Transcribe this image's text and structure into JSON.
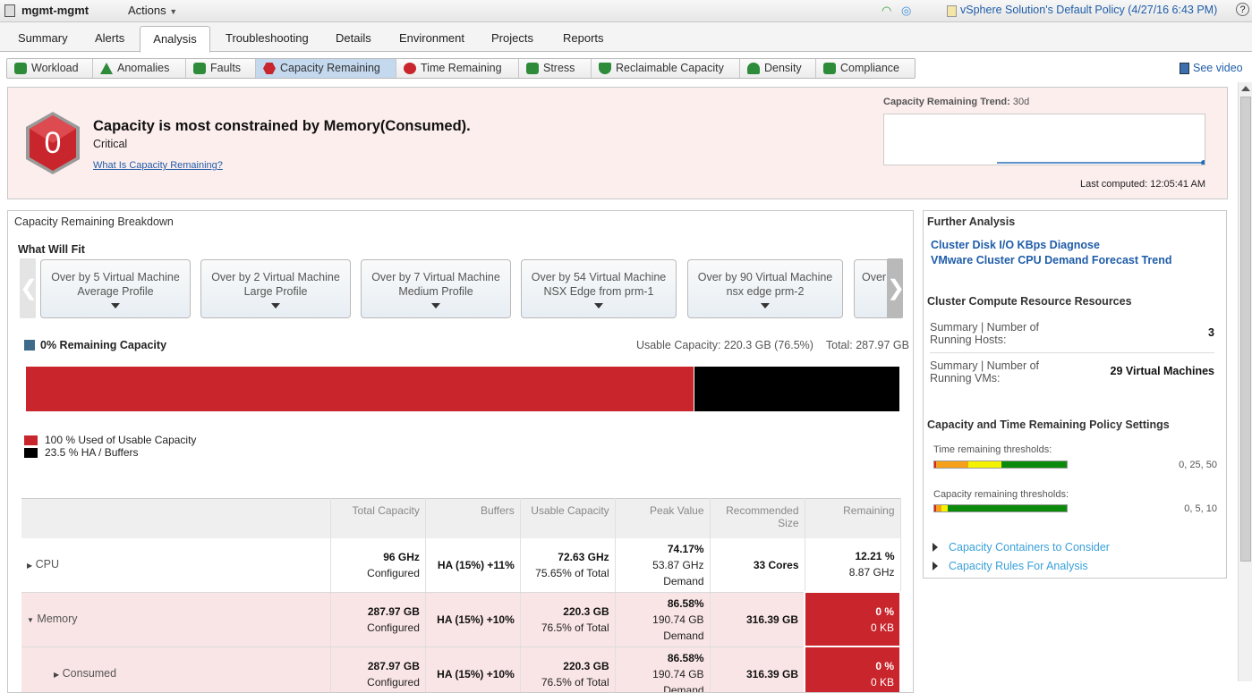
{
  "topbar": {
    "object_name": "mgmt-mgmt",
    "actions_label": "Actions",
    "policy_text": "vSphere Solution's Default Policy (4/27/16 6:43 PM)",
    "help_label": "?"
  },
  "tabs": [
    "Summary",
    "Alerts",
    "Analysis",
    "Troubleshooting",
    "Details",
    "Environment",
    "Projects",
    "Reports"
  ],
  "active_tab": "Analysis",
  "subtabs": [
    "Workload",
    "Anomalies",
    "Faults",
    "Capacity Remaining",
    "Time Remaining",
    "Stress",
    "Reclaimable Capacity",
    "Density",
    "Compliance"
  ],
  "active_subtab": "Capacity Remaining",
  "see_video": "See video",
  "summary": {
    "badge_value": "0",
    "headline": "Capacity is most constrained by Memory(Consumed).",
    "status": "Critical",
    "what_is_link": "What Is Capacity Remaining?",
    "trend_label": "Capacity Remaining Trend:",
    "trend_period": "30d",
    "last_computed": "Last computed: 12:05:41 AM"
  },
  "breakdown": {
    "title": "Capacity Remaining Breakdown",
    "what_will_fit": "What Will Fit",
    "fit_cards": [
      {
        "line1": "Over by 5 Virtual Machine",
        "line2": "Average Profile"
      },
      {
        "line1": "Over by 2 Virtual Machine",
        "line2": "Large Profile"
      },
      {
        "line1": "Over by 7 Virtual Machine",
        "line2": "Medium Profile"
      },
      {
        "line1": "Over by 54 Virtual Machine",
        "line2": "NSX Edge from prm-1"
      },
      {
        "line1": "Over by 90 Virtual Machine",
        "line2": "nsx edge prm-2"
      },
      {
        "line1": "Over",
        "line2": ""
      }
    ],
    "remaining_label": "0% Remaining Capacity",
    "usable_capacity": "Usable Capacity: 220.3 GB (76.5%)",
    "total": "Total: 287.97 GB",
    "bar": {
      "used_fraction": 0.765,
      "buffer_fraction": 0.235
    },
    "legend": {
      "used": "100 % Used of Usable Capacity",
      "buffers": "23.5 % HA / Buffers"
    },
    "table": {
      "headers": [
        "",
        "Total Capacity",
        "Buffers",
        "Usable Capacity",
        "Peak Value",
        "Recommended Size",
        "Remaining"
      ],
      "rows": [
        {
          "name": "CPU",
          "total": "96 GHz",
          "total_sub": "Configured",
          "buffers": "HA (15%) +11%",
          "usable": "72.63 GHz",
          "usable_sub": "75.65% of Total",
          "peak": "74.17%",
          "peak_sub1": "53.87 GHz",
          "peak_sub2": "Demand",
          "recommended": "33 Cores",
          "remaining": "12.21 %",
          "remaining_sub": "8.87 GHz"
        },
        {
          "name": "Memory",
          "total": "287.97 GB",
          "total_sub": "Configured",
          "buffers": "HA (15%) +10%",
          "usable": "220.3 GB",
          "usable_sub": "76.5% of Total",
          "peak": "86.58%",
          "peak_sub1": "190.74 GB",
          "peak_sub2": "Demand",
          "recommended": "316.39 GB",
          "remaining": "0 %",
          "remaining_sub": "0 KB"
        },
        {
          "name": "Consumed",
          "total": "287.97 GB",
          "total_sub": "Configured",
          "buffers": "HA (15%) +10%",
          "usable": "220.3 GB",
          "usable_sub": "76.5% of Total",
          "peak": "86.58%",
          "peak_sub1": "190.74 GB",
          "peak_sub2": "Demand",
          "recommended": "316.39 GB",
          "remaining": "0 %",
          "remaining_sub": "0 KB"
        }
      ]
    }
  },
  "further": {
    "title": "Further Analysis",
    "links": [
      "Cluster Disk I/O KBps Diagnose",
      "VMware Cluster CPU Demand Forecast Trend"
    ],
    "resources_title": "Cluster Compute Resource Resources",
    "kv": [
      {
        "key1": "Summary | Number of",
        "key2": "Running Hosts:",
        "value": "3"
      },
      {
        "key1": "Summary | Number of",
        "key2": "Running VMs:",
        "value": "29 Virtual Machines"
      }
    ],
    "policy_title": "Capacity and Time Remaining Policy Settings",
    "time_threshold_label": "Time remaining thresholds:",
    "time_threshold_values": "0, 25, 50",
    "capacity_threshold_label": "Capacity remaining thresholds:",
    "capacity_threshold_values": "0, 5, 10",
    "expanders": [
      "Capacity Containers to Consider",
      "Capacity Rules For Analysis"
    ]
  },
  "colors": {
    "critical": "#c9252c",
    "buffers": "#000000",
    "remaining": "#3e6b8a",
    "link": "#1f5da8",
    "threshold_red": "#d9261c",
    "threshold_orange": "#f7a11a",
    "threshold_yellow": "#f5f200",
    "threshold_green": "#0c8a0c"
  }
}
